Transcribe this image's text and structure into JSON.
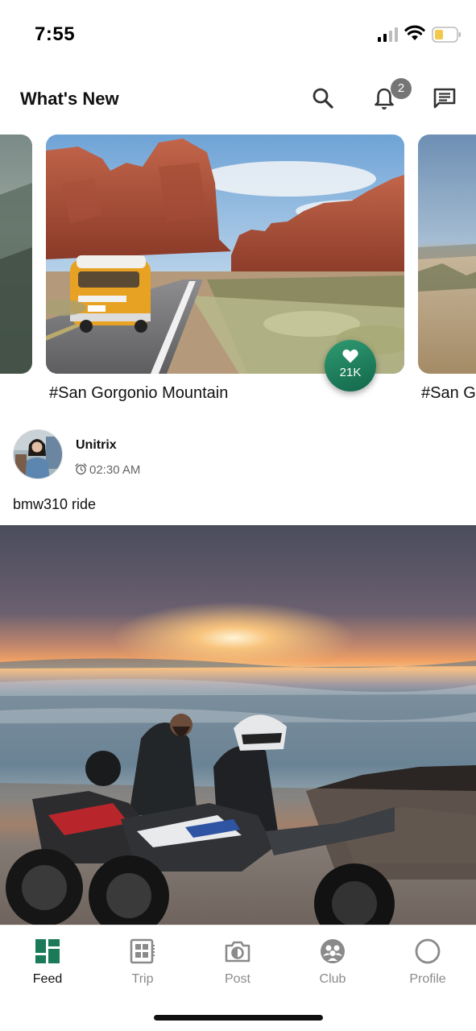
{
  "status_bar": {
    "time": "7:55"
  },
  "header": {
    "title": "What's New",
    "notification_count": "2"
  },
  "carousel": {
    "items": [
      {
        "caption": "#San Gorgonio Mountain",
        "likes": "21K"
      },
      {
        "caption": "#San G"
      }
    ]
  },
  "post": {
    "username": "Unitrix",
    "time": "02:30 AM",
    "text": "bmw310 ride"
  },
  "bottom_nav": {
    "items": [
      {
        "label": "Feed",
        "icon": "feed-icon",
        "active": true
      },
      {
        "label": "Trip",
        "icon": "trip-icon",
        "active": false
      },
      {
        "label": "Post",
        "icon": "camera-icon",
        "active": false
      },
      {
        "label": "Club",
        "icon": "club-icon",
        "active": false
      },
      {
        "label": "Profile",
        "icon": "profile-icon",
        "active": false
      }
    ]
  },
  "colors": {
    "accent": "#1b7a57",
    "badge": "#757575",
    "inactive_nav": "#8a8a8a"
  }
}
